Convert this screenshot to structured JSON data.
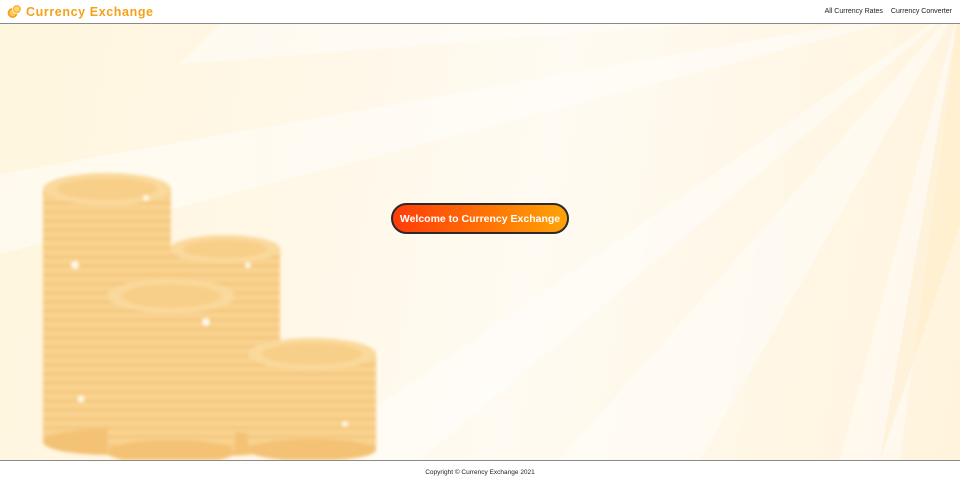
{
  "header": {
    "brand_title": "Currency Exchange",
    "brand_icon": "coins-icon",
    "nav": [
      {
        "label": "All Currency Rates"
      },
      {
        "label": "Currency Converter"
      }
    ]
  },
  "hero": {
    "welcome_label": "Welcome to Currency Exchange"
  },
  "footer": {
    "copyright": "Copyright © Currency Exchange 2021"
  },
  "colors": {
    "brand": "#f4a21a",
    "button_start": "#ff3c0a",
    "button_end": "#ffa306",
    "hero_background": "#fff6de"
  }
}
